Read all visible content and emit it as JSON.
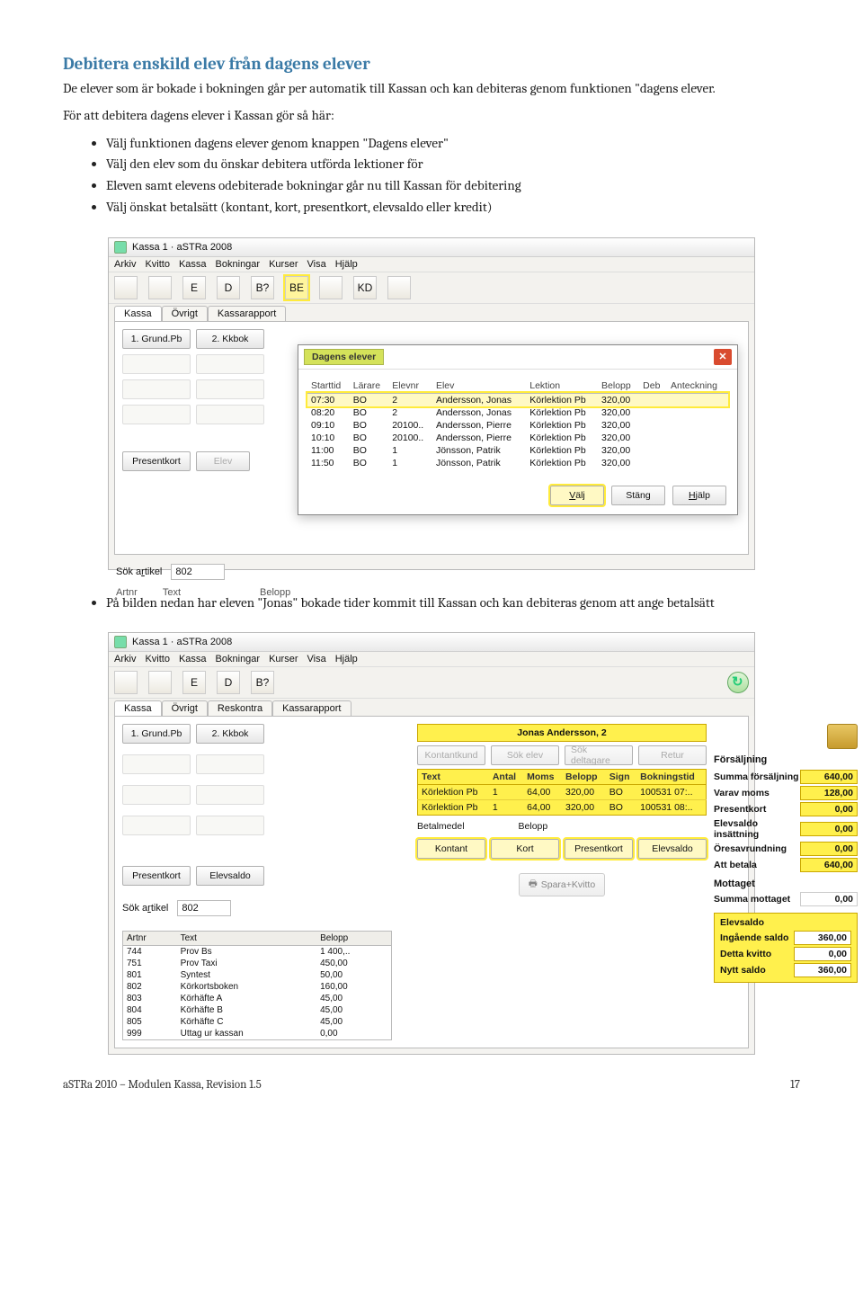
{
  "doc": {
    "title": "Debitera enskild elev från dagens elever",
    "intro": "De elever som är bokade i bokningen går per automatik till Kassan och kan debiteras genom funktionen \"dagens elever.",
    "para2": "För att debitera dagens elever i Kassan gör så här:",
    "bullets1": [
      "Välj funktionen dagens elever genom knappen \"Dagens elever\"",
      "Välj den elev som du önskar debitera utförda lektioner för",
      "Eleven samt elevens odebiterade bokningar går nu till Kassan för debitering",
      "Välj önskat betalsätt (kontant, kort, presentkort, elevsaldo eller kredit)"
    ],
    "bullets2": [
      "På bilden nedan har eleven \"Jonas\" bokade tider kommit till Kassan och kan debiteras genom att ange betalsätt"
    ],
    "footer_left": "aSTRa 2010 – Modulen Kassa, Revision 1.5",
    "footer_right": "17"
  },
  "s1": {
    "window_title": "Kassa 1 · aSTRa 2008",
    "menus": [
      "Arkiv",
      "Kvitto",
      "Kassa",
      "Bokningar",
      "Kurser",
      "Visa",
      "Hjälp"
    ],
    "tb_icons": [
      "",
      "",
      "E",
      "D",
      "B?",
      "BE",
      "",
      "KD",
      ""
    ],
    "tabs": [
      "Kassa",
      "Övrigt",
      "Kassarapport"
    ],
    "quick_buttons": [
      "1. Grund.Pb",
      "2. Kkbok"
    ],
    "presentkort": "Presentkort",
    "elev_label": "Elev",
    "sok_artikel_label": "Sök artikel",
    "sok_artikel_value": "802",
    "artnr_label": "Artnr",
    "text_label": "Text",
    "belopp_label": "Belopp",
    "popup": {
      "title": "Dagens elever",
      "headers": [
        "Starttid",
        "Lärare",
        "Elevnr",
        "Elev",
        "Lektion",
        "Belopp",
        "Deb",
        "Anteckning"
      ],
      "rows": [
        {
          "start": "07:30",
          "larare": "BO",
          "elevnr": "2",
          "elev": "Andersson, Jonas",
          "lektion": "Körlektion Pb",
          "belopp": "320,00",
          "sel": true
        },
        {
          "start": "08:20",
          "larare": "BO",
          "elevnr": "2",
          "elev": "Andersson, Jonas",
          "lektion": "Körlektion Pb",
          "belopp": "320,00"
        },
        {
          "start": "09:10",
          "larare": "BO",
          "elevnr": "20100..",
          "elev": "Andersson, Pierre",
          "lektion": "Körlektion Pb",
          "belopp": "320,00"
        },
        {
          "start": "10:10",
          "larare": "BO",
          "elevnr": "20100..",
          "elev": "Andersson, Pierre",
          "lektion": "Körlektion Pb",
          "belopp": "320,00"
        },
        {
          "start": "11:00",
          "larare": "BO",
          "elevnr": "1",
          "elev": "Jönsson, Patrik",
          "lektion": "Körlektion Pb",
          "belopp": "320,00"
        },
        {
          "start": "11:50",
          "larare": "BO",
          "elevnr": "1",
          "elev": "Jönsson, Patrik",
          "lektion": "Körlektion Pb",
          "belopp": "320,00"
        }
      ],
      "btn_valj": "Välj",
      "btn_stang": "Stäng",
      "btn_hjalp": "Hjälp"
    }
  },
  "s2": {
    "window_title": "Kassa 1 · aSTRa 2008",
    "menus": [
      "Arkiv",
      "Kvitto",
      "Kassa",
      "Bokningar",
      "Kurser",
      "Visa",
      "Hjälp"
    ],
    "tabs": [
      "Kassa",
      "Övrigt",
      "Reskontra",
      "Kassarapport"
    ],
    "quick_buttons": [
      "1. Grund.Pb",
      "2. Kkbok"
    ],
    "presentkort": "Presentkort",
    "elevsaldo_btn": "Elevsaldo",
    "customer_strip": "Jonas Andersson, 2",
    "disabled_btns": [
      "Kontantkund",
      "Sök elev",
      "Sök deltagare",
      "Retur"
    ],
    "line_headers": [
      "Text",
      "Antal",
      "Moms",
      "Belopp",
      "Sign",
      "Bokningstid"
    ],
    "lines": [
      {
        "text": "Körlektion Pb",
        "antal": "1",
        "moms": "64,00",
        "belopp": "320,00",
        "sign": "BO",
        "bok": "100531 07:.."
      },
      {
        "text": "Körlektion Pb",
        "antal": "1",
        "moms": "64,00",
        "belopp": "320,00",
        "sign": "BO",
        "bok": "100531 08:.."
      }
    ],
    "summary_head": "Försäljning",
    "sum_rows": [
      {
        "lab": "Summa försäljning",
        "val": "640,00"
      },
      {
        "lab": "Varav moms",
        "val": "128,00"
      },
      {
        "lab": "Presentkort",
        "val": "0,00"
      },
      {
        "lab": "Elevsaldo insättning",
        "val": "0,00"
      },
      {
        "lab": "Öresavrundning",
        "val": "0,00"
      },
      {
        "lab": "Att betala",
        "val": "640,00"
      }
    ],
    "mottaget_head": "Mottaget",
    "mottaget_row": {
      "lab": "Summa mottaget",
      "val": "0,00"
    },
    "elevsaldo_head": "Elevsaldo",
    "elevsaldo_rows": [
      {
        "lab": "Ingående saldo",
        "val": "360,00"
      },
      {
        "lab": "Detta kvitto",
        "val": "0,00"
      },
      {
        "lab": "Nytt saldo",
        "val": "360,00"
      }
    ],
    "pay_btns": [
      "Kontant",
      "Kort",
      "Presentkort",
      "Elevsaldo"
    ],
    "betalmedel_label": "Betalmedel",
    "belopp_label2": "Belopp",
    "spara": "Spara+Kvitto",
    "sok_artikel_label": "Sök artikel",
    "sok_artikel_value": "802",
    "art_headers": [
      "Artnr",
      "Text",
      "Belopp"
    ],
    "articles": [
      {
        "n": "744",
        "t": "Prov Bs",
        "b": "1 400,.."
      },
      {
        "n": "751",
        "t": "Prov Taxi",
        "b": "450,00"
      },
      {
        "n": "801",
        "t": "Syntest",
        "b": "50,00"
      },
      {
        "n": "802",
        "t": "Körkortsboken",
        "b": "160,00"
      },
      {
        "n": "803",
        "t": "Körhäfte A",
        "b": "45,00"
      },
      {
        "n": "804",
        "t": "Körhäfte B",
        "b": "45,00"
      },
      {
        "n": "805",
        "t": "Körhäfte C",
        "b": "45,00"
      },
      {
        "n": "999",
        "t": "Uttag ur kassan",
        "b": "0,00"
      }
    ]
  }
}
